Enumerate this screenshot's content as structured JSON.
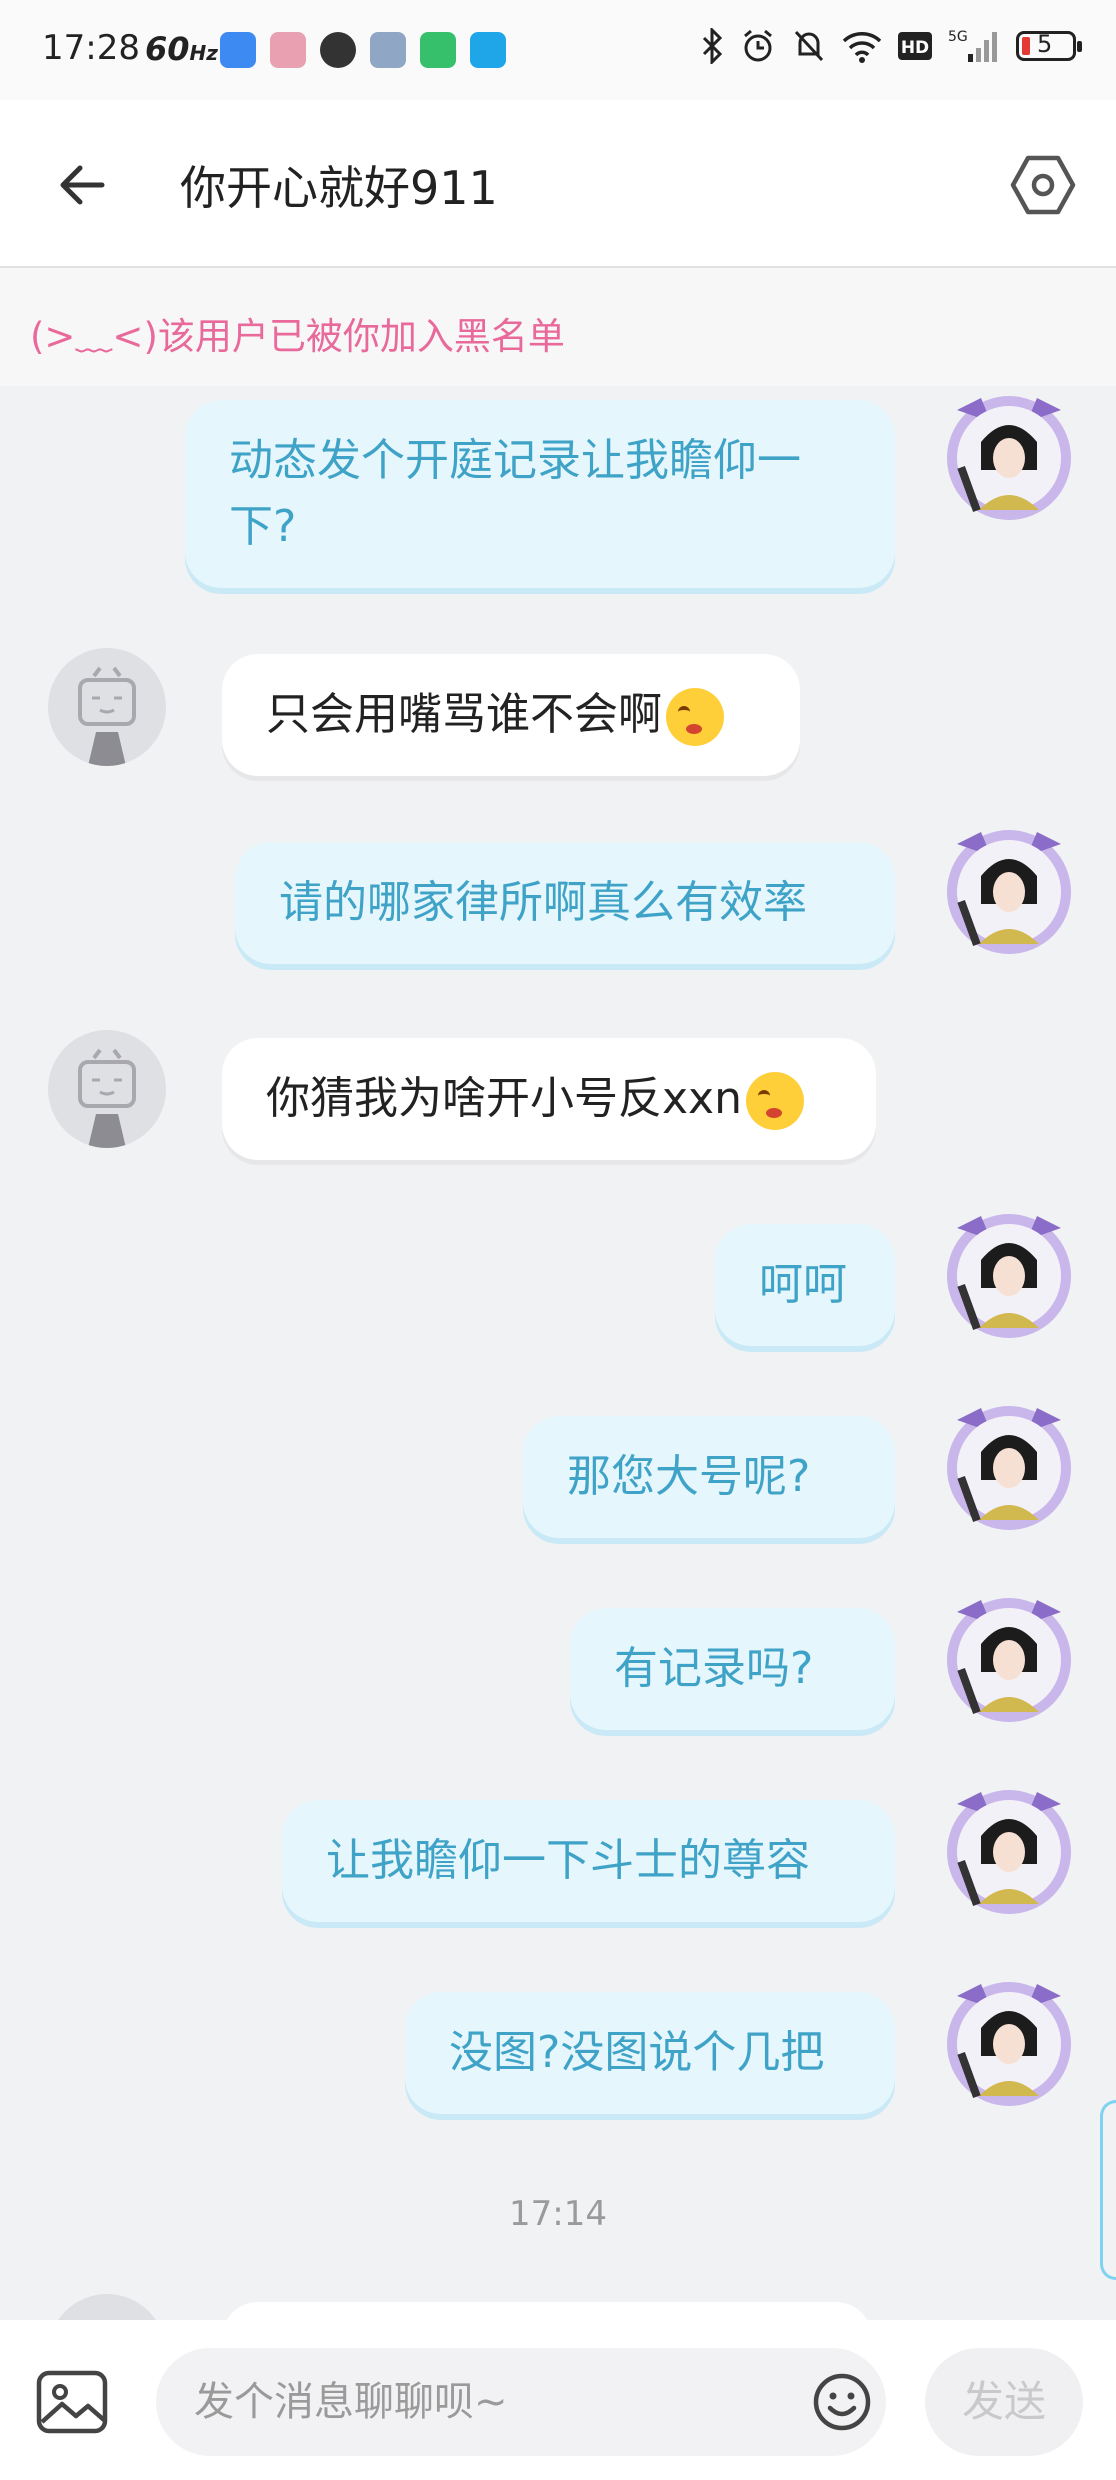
{
  "status_bar": {
    "time": "17:28",
    "refresh_rate": "60",
    "refresh_unit": "Hz",
    "battery": "5",
    "network": "5G",
    "hd": "HD"
  },
  "header": {
    "title": "你开心就好911",
    "back_icon": "back-arrow-icon",
    "settings_icon": "hexagon-settings-icon"
  },
  "notice": "(>﹏<)该用户已被你加入黑名单",
  "messages": [
    {
      "side": "me",
      "text_line1": "动态发个开庭记录让我瞻仰一",
      "text_line2": "下?"
    },
    {
      "side": "them",
      "text": "只会用嘴骂谁不会啊"
    },
    {
      "side": "me",
      "text": "请的哪家律所啊真么有效率"
    },
    {
      "side": "them",
      "text": "你猜我为啥开小号反xxn"
    },
    {
      "side": "me",
      "text": "呵呵"
    },
    {
      "side": "me",
      "text": "那您大号呢?"
    },
    {
      "side": "me",
      "text": "有记录吗?"
    },
    {
      "side": "me",
      "text": "让我瞻仰一下斗士的尊容"
    },
    {
      "side": "me",
      "text": "没图?没图说个几把"
    }
  ],
  "timestamp": "17:14",
  "input": {
    "placeholder": "发个消息聊聊呗~",
    "send_label": "发送"
  },
  "colors": {
    "my_bubble": "#e5f6fc",
    "my_text": "#3fa3c7",
    "notice_text": "#e8699a"
  }
}
